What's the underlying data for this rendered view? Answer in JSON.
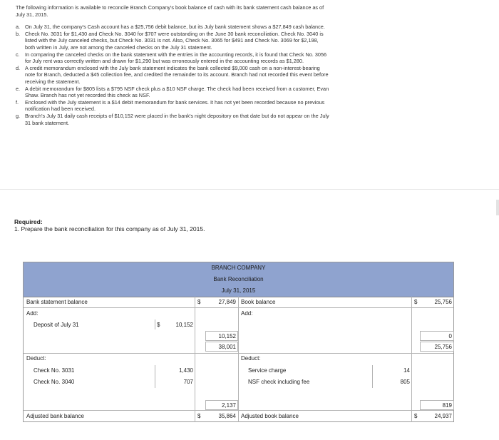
{
  "problem": {
    "intro": "The following information is available to reconcile Branch Company's book balance of cash with its bank statement cash balance as of July 31, 2015.",
    "items": [
      {
        "letter": "a.",
        "text": "On July 31, the company's Cash account has a $25,756 debit balance, but its July bank statement shows a $27,849 cash balance."
      },
      {
        "letter": "b.",
        "text": "Check No. 3031 for $1,430 and Check No. 3040 for $707 were outstanding on the June 30 bank reconciliation. Check No. 3040 is listed with the July canceled checks, but Check No. 3031 is not. Also, Check No. 3065 for $491 and Check No. 3069 for $2,198, both written in July, are not among the canceled checks on the July 31 statement."
      },
      {
        "letter": "c.",
        "text": "In comparing the canceled checks on the bank statement with the entries in the accounting records, it is found that Check No. 3056 for July rent was correctly written and drawn for $1,290 but was erroneously entered in the accounting records as $1,280."
      },
      {
        "letter": "d.",
        "text": "A credit memorandum enclosed with the July bank statement indicates the bank collected $9,000 cash on a non-interest-bearing note for Branch, deducted a $45 collection fee, and credited the remainder to its account. Branch had not recorded this event before receiving the statement."
      },
      {
        "letter": "e.",
        "text": "A debit memorandum for $805 lists a $795 NSF check plus a $10 NSF charge. The check had been received from a customer, Evan Shaw. Branch has not yet recorded this check as NSF."
      },
      {
        "letter": "f.",
        "text": "Enclosed with the July statement is a $14 debit memorandum for bank services. It has not yet been recorded because no previous notification had been received."
      },
      {
        "letter": "g.",
        "text": "Branch's July 31 daily cash receipts of $10,152 were placed in the bank's night depository on that date but do not appear on the July 31 bank statement."
      }
    ]
  },
  "required": {
    "heading": "Required:",
    "instruction": "1. Prepare the bank reconciliation for this company as of July 31, 2015."
  },
  "recon": {
    "company": "BRANCH COMPANY",
    "title": "Bank Reconciliation",
    "date": "July 31, 2015",
    "bank_side": {
      "balance_label": "Bank statement balance",
      "balance_dollar": "$",
      "balance_value": "27,849",
      "add_label": "Add:",
      "deposit_label": "Deposit of July 31",
      "deposit_dollar": "$",
      "deposit_value": "10,152",
      "add_total": "10,152",
      "subtotal": "38,001",
      "deduct_label": "Deduct:",
      "check1_label": "Check No. 3031",
      "check1_value": "1,430",
      "check2_label": "Check No. 3040",
      "check2_value": "707",
      "deduct_total": "2,137",
      "adjusted_label": "Adjusted bank balance",
      "adjusted_dollar": "$",
      "adjusted_value": "35,864"
    },
    "book_side": {
      "balance_label": "Book balance",
      "balance_dollar": "$",
      "balance_value": "25,756",
      "add_label": "Add:",
      "add_total": "0",
      "subtotal": "25,756",
      "deduct_label": "Deduct:",
      "charge1_label": "Service charge",
      "charge1_value": "14",
      "charge2_label": "NSF check including fee",
      "charge2_value": "805",
      "deduct_total": "819",
      "adjusted_label": "Adjusted book balance",
      "adjusted_dollar": "$",
      "adjusted_value": "24,937"
    }
  }
}
